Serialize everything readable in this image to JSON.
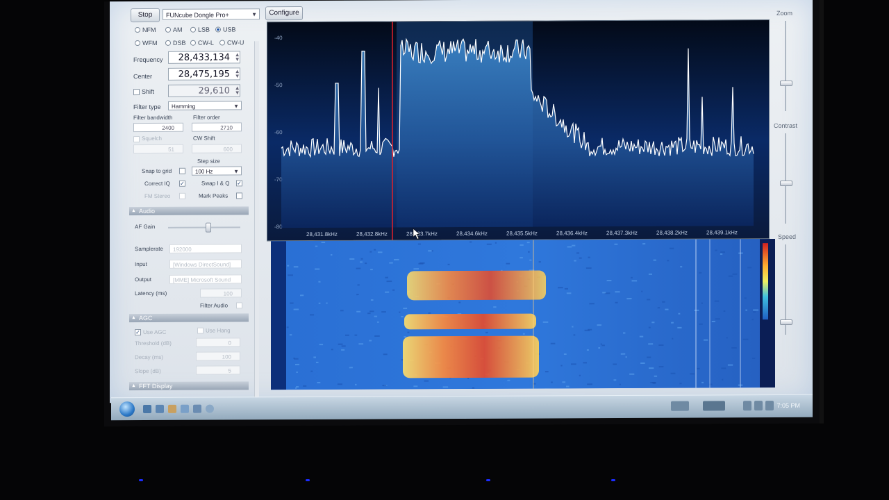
{
  "toolbar": {
    "stop_label": "Stop",
    "device_select": "FUNcube Dongle Pro+",
    "configure_label": "Configure"
  },
  "radio": {
    "modes": [
      {
        "label": "NFM",
        "selected": false
      },
      {
        "label": "AM",
        "selected": false
      },
      {
        "label": "LSB",
        "selected": false
      },
      {
        "label": "USB",
        "selected": true
      },
      {
        "label": "WFM",
        "selected": false
      },
      {
        "label": "DSB",
        "selected": false
      },
      {
        "label": "CW-L",
        "selected": false
      },
      {
        "label": "CW-U",
        "selected": false
      }
    ],
    "frequency_label": "Frequency",
    "frequency_value": "28,433,134",
    "center_label": "Center",
    "center_value": "28,475,195",
    "shift_label": "Shift",
    "shift_value": "29,610",
    "filter_type_label": "Filter type",
    "filter_type_value": "Hamming",
    "filter_bandwidth_label": "Filter bandwidth",
    "filter_bandwidth_value": "2400",
    "filter_order_label": "Filter order",
    "filter_order_value": "2710",
    "squelch_label": "Squelch",
    "squelch_value": "51",
    "cw_shift_label": "CW Shift",
    "cw_shift_value": "600",
    "snap_to_grid_label": "Snap to grid",
    "step_size_label": "Step size",
    "step_size_value": "100 Hz",
    "correct_iq_label": "Correct IQ",
    "swap_iq_label": "Swap I & Q",
    "fm_stereo_label": "FM Stereo",
    "mark_peaks_label": "Mark Peaks"
  },
  "audio": {
    "section_label": "Audio",
    "af_gain_label": "AF Gain",
    "af_gain_level": 0.55,
    "samplerate_label": "Samplerate",
    "samplerate_value": "192000",
    "input_label": "Input",
    "input_value": "[Windows DirectSound]",
    "output_label": "Output",
    "output_value": "[MME] Microsoft Sound",
    "latency_label": "Latency (ms)",
    "latency_value": "100",
    "filter_audio_label": "Filter Audio"
  },
  "agc": {
    "section_label": "AGC",
    "use_agc_label": "Use AGC",
    "use_hang_label": "Use Hang",
    "threshold_label": "Threshold (dB)",
    "threshold_value": "0",
    "decay_label": "Decay (ms)",
    "decay_value": "100",
    "slope_label": "Slope (dB)",
    "slope_value": "5"
  },
  "fft_section_label": "FFT Display",
  "spectrum": {
    "db_ticks": [
      "-40",
      "-50",
      "-60",
      "-70",
      "-80"
    ],
    "freq_ticks": [
      "28,431.8kHz",
      "28,432.8kHz",
      "28,433.7kHz",
      "28,434.6kHz",
      "28,435.5kHz",
      "28,436.4kHz",
      "28,437.3kHz",
      "28,438.2kHz",
      "28,439.1kHz"
    ]
  },
  "right_panel": {
    "zoom_label": "Zoom",
    "contrast_label": "Contrast",
    "speed_label": "Speed"
  },
  "taskbar": {
    "time": "7:05 PM"
  },
  "colors": {
    "spectrum_bg": "#050d1e",
    "signal_fill": "#3a86d6",
    "trace": "#ffffff",
    "tuning_line": "#e0202a",
    "waterfall_base": "#1f5fc4"
  }
}
